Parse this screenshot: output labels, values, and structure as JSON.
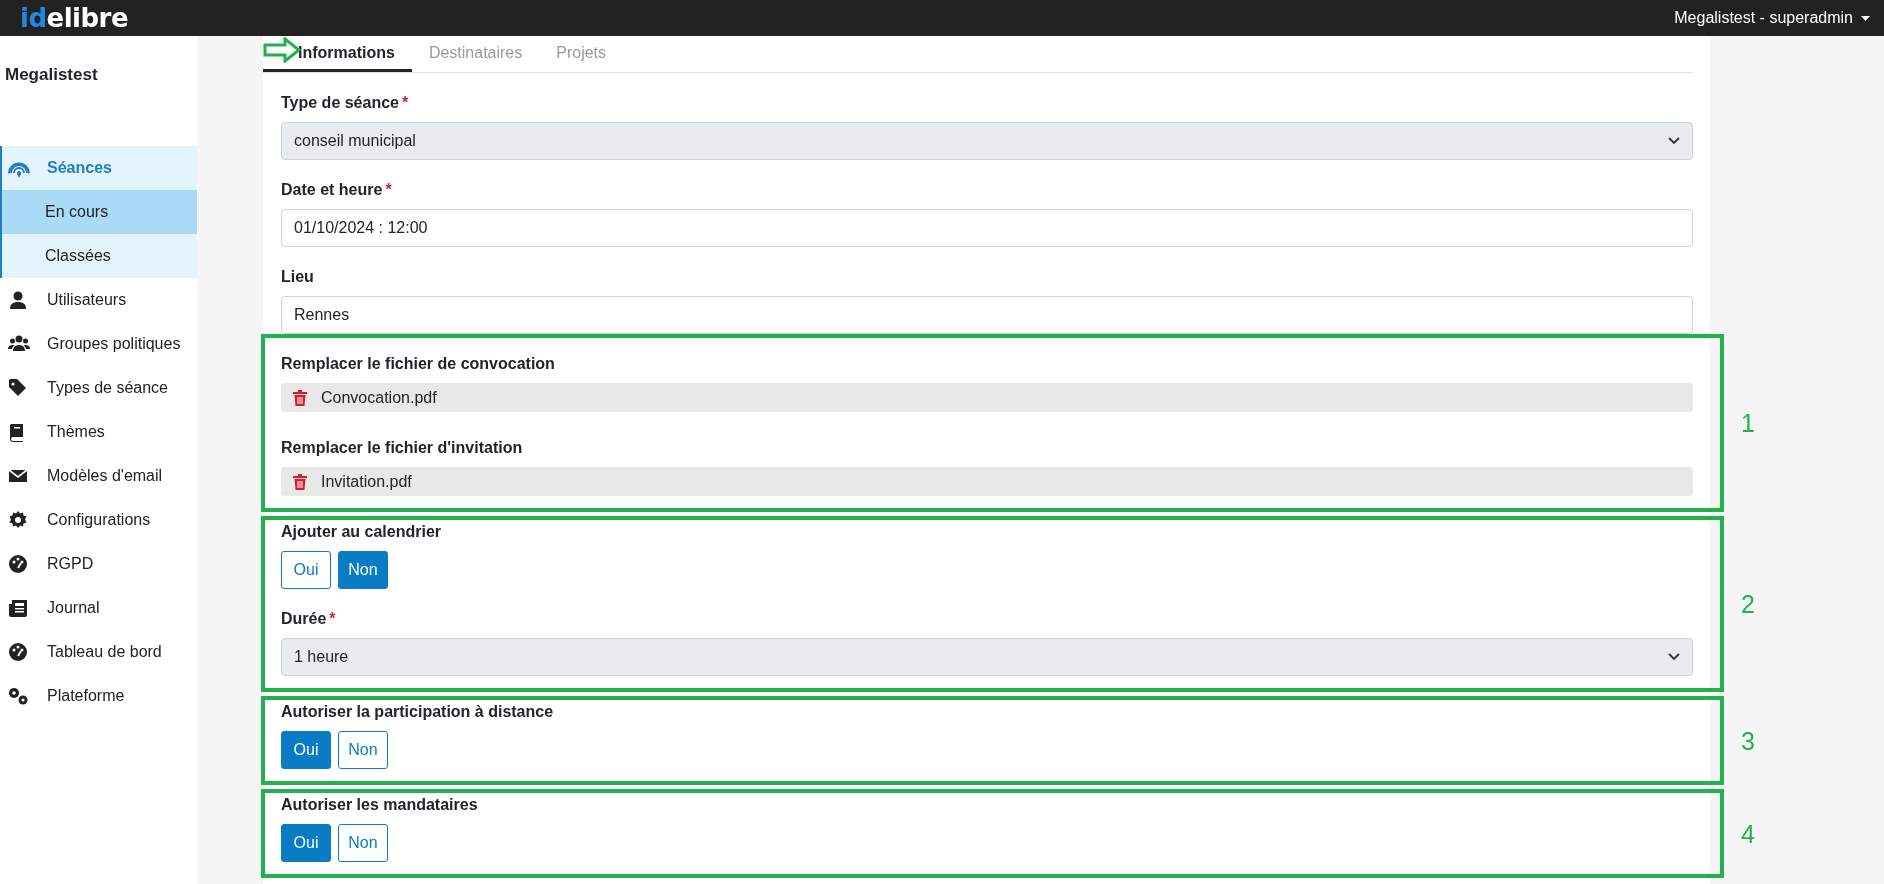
{
  "header": {
    "logo_prefix": "id",
    "logo_suffix": "elibre",
    "user_menu": "Megalistest - superadmin"
  },
  "sidebar": {
    "title": "Megalistest",
    "items": [
      {
        "label": "Séances",
        "expanded": true,
        "children": [
          {
            "label": "En cours",
            "selected": true
          },
          {
            "label": "Classées",
            "selected": false
          }
        ]
      },
      {
        "label": "Utilisateurs",
        "expanded": false
      },
      {
        "label": "Groupes politiques",
        "expanded": false
      },
      {
        "label": "Types de séance",
        "expanded": false
      },
      {
        "label": "Thèmes",
        "expanded": false
      },
      {
        "label": "Modèles d'email",
        "expanded": false
      },
      {
        "label": "Configurations",
        "expanded": false
      },
      {
        "label": "RGPD",
        "expanded": false
      },
      {
        "label": "Journal",
        "expanded": false
      },
      {
        "label": "Tableau de bord",
        "expanded": false
      },
      {
        "label": "Plateforme",
        "expanded": false
      }
    ]
  },
  "tabs": [
    {
      "label": "Informations",
      "selected": true
    },
    {
      "label": "Destinataires",
      "selected": false
    },
    {
      "label": "Projets",
      "selected": false
    }
  ],
  "form": [
    {
      "kind": "select",
      "label": "Type de séance",
      "required_mark": "*",
      "value": "conseil municipal"
    },
    {
      "kind": "text",
      "label": "Date et heure",
      "required_mark": "*",
      "value": "01/10/2024 : 12:00"
    },
    {
      "kind": "text",
      "label": "Lieu",
      "value": "Rennes"
    },
    {
      "kind": "group",
      "marker": "1",
      "fields": [
        {
          "kind": "file",
          "label": "Remplacer le fichier de convocation",
          "file": "Convocation.pdf"
        },
        {
          "kind": "file",
          "label": "Remplacer le fichier d'invitation",
          "file": "Invitation.pdf"
        }
      ]
    },
    {
      "kind": "group",
      "marker": "2",
      "fields": [
        {
          "kind": "toggle",
          "label": "Ajouter au calendrier",
          "options": [
            {
              "label": "Oui",
              "selected": false
            },
            {
              "label": "Non",
              "selected": true
            }
          ]
        },
        {
          "kind": "select",
          "label": "Durée",
          "required_mark": "*",
          "value": "1 heure"
        }
      ]
    },
    {
      "kind": "group",
      "marker": "3",
      "fields": [
        {
          "kind": "toggle",
          "label": "Autoriser la participation à distance",
          "options": [
            {
              "label": "Oui",
              "selected": true
            },
            {
              "label": "Non",
              "selected": false
            }
          ]
        }
      ]
    },
    {
      "kind": "group",
      "marker": "4",
      "fields": [
        {
          "kind": "toggle",
          "label": "Autoriser les mandataires",
          "options": [
            {
              "label": "Oui",
              "selected": true
            },
            {
              "label": "Non",
              "selected": false
            }
          ]
        }
      ]
    }
  ]
}
